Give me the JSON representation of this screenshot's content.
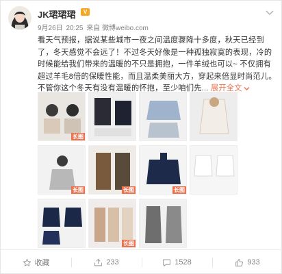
{
  "post": {
    "username": "JK珺珺珺",
    "vip_badge": "V",
    "date": "9月26日",
    "time": "20:25",
    "source_prefix": "来自",
    "source": "微博weibo.com",
    "text": "看天气预报，据说某些城市一夜之间温度骤降十多度，秋天已经到了，冬天感觉不会远了！不过冬天好像是一种孤独寂寞的表现，冷的时候能给我们带来的温暖的不只是拥抱，一件羊绒也可以~ 不仅拥有超过羊毛8倍的保暖性能，而且温柔美丽大方，穿起来倍显时尚范儿。不管你这个冬天有没有温暖的怀抱，至少咱们先...",
    "expand_label": "展开全文",
    "expand_icon": "chevron-down-icon"
  },
  "images": {
    "long_tag": "长图",
    "items": [
      {
        "name": "image-models-portraits",
        "bg": "#e9e6e2",
        "long": true
      },
      {
        "name": "image-black-coat-models",
        "bg": "#efefef",
        "long": false
      },
      {
        "name": "image-grey-sweaters",
        "bg": "#f1f1f1",
        "long": false
      },
      {
        "name": "image-white-jacket-layout",
        "bg": "#ededed",
        "long": false
      },
      {
        "name": "image-woman-grey-sweater",
        "bg": "#f2f2f2",
        "long": true
      },
      {
        "name": "image-brown-coats",
        "bg": "#efece8",
        "long": true
      },
      {
        "name": "image-navy-sweater",
        "bg": "#f4f4f4",
        "long": true
      },
      {
        "name": "image-white-sweaters",
        "bg": "#f6f6f6",
        "long": false
      },
      {
        "name": "image-navy-knitwear",
        "bg": "#f2f2f2",
        "long": false
      },
      {
        "name": "image-women-looks",
        "bg": "#efeceb",
        "long": true
      },
      {
        "name": "image-grey-coats",
        "bg": "#f1f1f1",
        "long": false
      }
    ]
  },
  "actions": [
    {
      "label": "收藏",
      "icon": "star-icon"
    },
    {
      "label": "233",
      "icon": "share-icon"
    },
    {
      "label": "1528",
      "icon": "comment-icon"
    },
    {
      "label": "933",
      "icon": "like-icon"
    }
  ],
  "colors": {
    "accent": "#eb7350",
    "vip": "#f5a623",
    "meta_text": "#808080"
  }
}
